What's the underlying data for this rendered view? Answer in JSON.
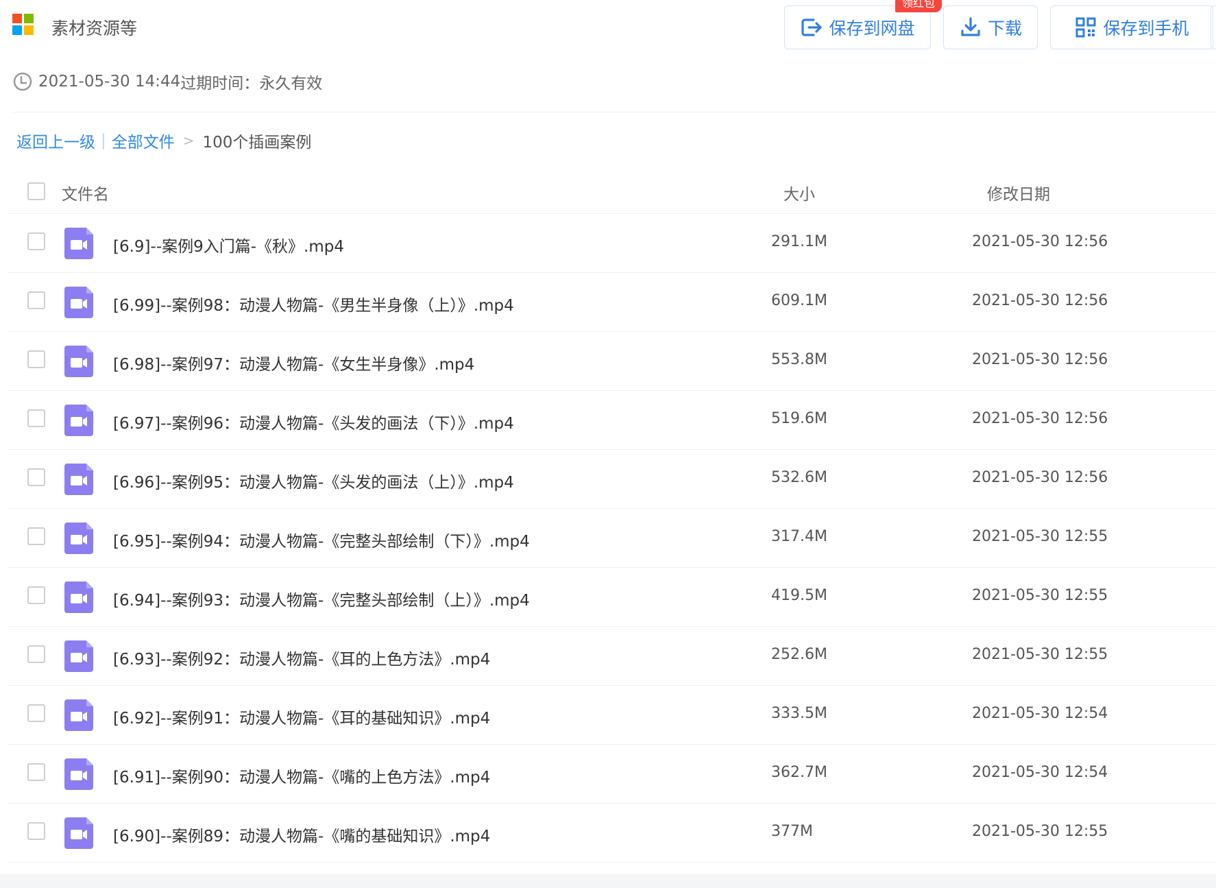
{
  "app": {
    "title": "素材资源等",
    "logo_colors": [
      "#f25022",
      "#7fba00",
      "#00a4ef",
      "#ffb900"
    ]
  },
  "toolbar": {
    "save_to_cloud_label": "保存到网盘",
    "red_packet_badge": "领红包",
    "download_label": "下载",
    "save_to_phone_label": "保存到手机"
  },
  "meta": {
    "created_at": "2021-05-30 14:44",
    "expire_label": "过期时间：",
    "expire_value": "永久有效"
  },
  "breadcrumb": {
    "back_label": "返回上一级",
    "all_files_label": "全部文件",
    "current_folder": "100个插画案例"
  },
  "table": {
    "columns": {
      "name": "文件名",
      "size": "大小",
      "date": "修改日期"
    },
    "rows": [
      {
        "name": "[6.9]--案例9入门篇-《秋》.mp4",
        "size": "291.1M",
        "date": "2021-05-30 12:56"
      },
      {
        "name": "[6.99]--案例98：动漫人物篇-《男生半身像（上）》.mp4",
        "size": "609.1M",
        "date": "2021-05-30 12:56"
      },
      {
        "name": "[6.98]--案例97：动漫人物篇-《女生半身像》.mp4",
        "size": "553.8M",
        "date": "2021-05-30 12:56"
      },
      {
        "name": "[6.97]--案例96：动漫人物篇-《头发的画法（下）》.mp4",
        "size": "519.6M",
        "date": "2021-05-30 12:56"
      },
      {
        "name": "[6.96]--案例95：动漫人物篇-《头发的画法（上）》.mp4",
        "size": "532.6M",
        "date": "2021-05-30 12:56"
      },
      {
        "name": "[6.95]--案例94：动漫人物篇-《完整头部绘制（下）》.mp4",
        "size": "317.4M",
        "date": "2021-05-30 12:55"
      },
      {
        "name": "[6.94]--案例93：动漫人物篇-《完整头部绘制（上）》.mp4",
        "size": "419.5M",
        "date": "2021-05-30 12:55"
      },
      {
        "name": "[6.93]--案例92：动漫人物篇-《耳的上色方法》.mp4",
        "size": "252.6M",
        "date": "2021-05-30 12:55"
      },
      {
        "name": "[6.92]--案例91：动漫人物篇-《耳的基础知识》.mp4",
        "size": "333.5M",
        "date": "2021-05-30 12:54"
      },
      {
        "name": "[6.91]--案例90：动漫人物篇-《嘴的上色方法》.mp4",
        "size": "362.7M",
        "date": "2021-05-30 12:54"
      },
      {
        "name": "[6.90]--案例89：动漫人物篇-《嘴的基础知识》.mp4",
        "size": "377M",
        "date": "2021-05-30 12:55"
      }
    ]
  },
  "icons": {
    "file_type": "video-file-icon",
    "file_icon_color": "#8c7ef0",
    "accent_color": "#2f7fe0",
    "badge_color": "#f5463d"
  }
}
